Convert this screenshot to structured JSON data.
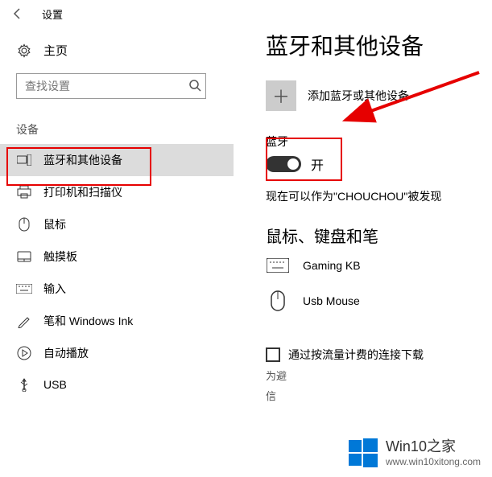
{
  "window": {
    "title": "设置"
  },
  "sidebar": {
    "home": "主页",
    "search_placeholder": "查找设置",
    "group": "设备",
    "items": [
      {
        "label": "蓝牙和其他设备"
      },
      {
        "label": "打印机和扫描仪"
      },
      {
        "label": "鼠标"
      },
      {
        "label": "触摸板"
      },
      {
        "label": "输入"
      },
      {
        "label": "笔和 Windows Ink"
      },
      {
        "label": "自动播放"
      },
      {
        "label": "USB"
      }
    ]
  },
  "page": {
    "title": "蓝牙和其他设备",
    "add_label": "添加蓝牙或其他设备",
    "bt_section": "蓝牙",
    "toggle_state": "开",
    "discoverable": "现在可以作为\"CHOUCHOU\"被发现",
    "devices_heading": "鼠标、键盘和笔",
    "devices": [
      {
        "name": "Gaming KB"
      },
      {
        "name": "Usb Mouse"
      }
    ],
    "checkbox_label": "通过按流量计费的连接下载",
    "note_prefix": "为避",
    "note_line2": "信"
  },
  "watermark": {
    "title": "Win10之家",
    "url": "www.win10xitong.com"
  }
}
